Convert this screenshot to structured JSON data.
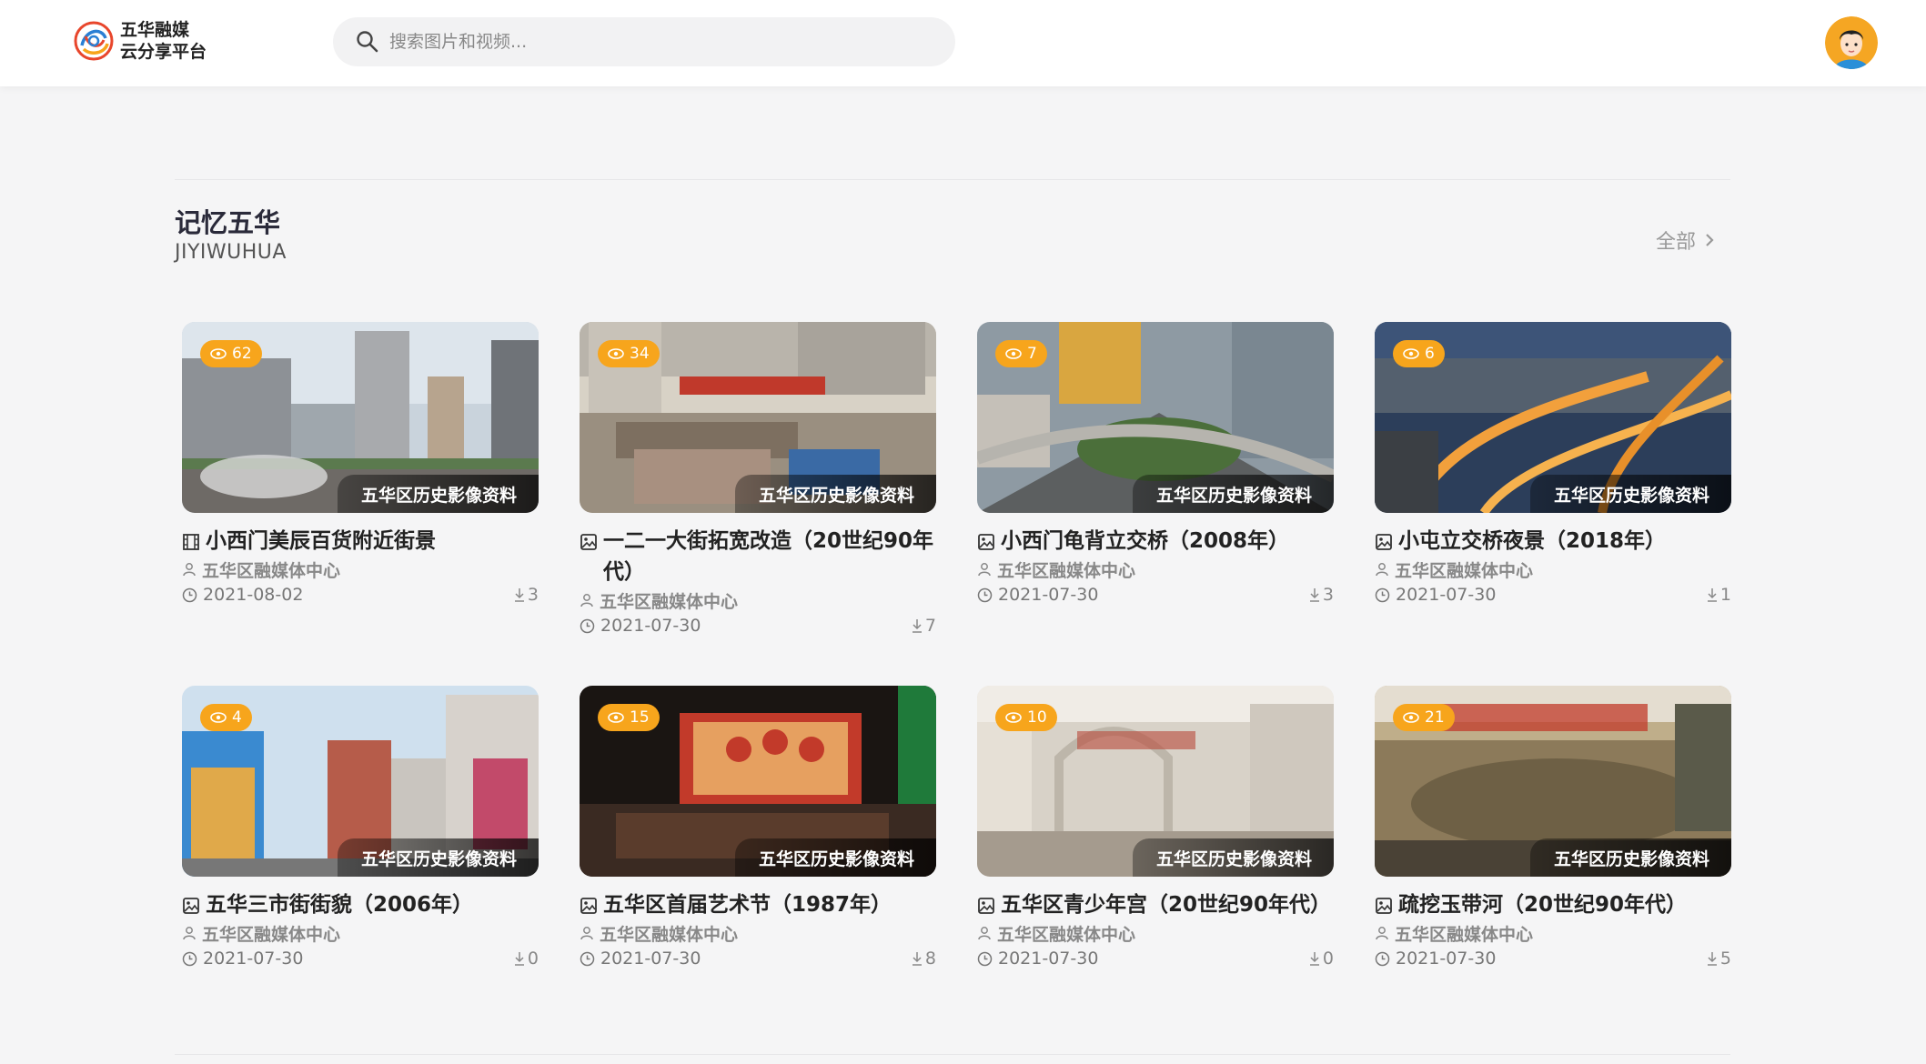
{
  "brand": {
    "line1": "五华融媒",
    "line2": "云分享平台"
  },
  "search": {
    "placeholder": "搜索图片和视频..."
  },
  "section": {
    "title": "记忆五华",
    "subtitle": "JIYIWUHUA",
    "more_label": "全部"
  },
  "colors": {
    "accent": "#f7a51c",
    "text": "#222222",
    "muted": "#888888"
  },
  "cards": [
    {
      "title": "小西门美辰百货附近街景",
      "type": "video",
      "type_icon": "film-icon",
      "views": "62",
      "tag": "五华区历史影像资料",
      "author": "五华区融媒体中心",
      "date": "2021-08-02",
      "downloads": "3"
    },
    {
      "title": "一二一大街拓宽改造（20世纪90年代）",
      "type": "image",
      "type_icon": "image-icon",
      "views": "34",
      "tag": "五华区历史影像资料",
      "author": "五华区融媒体中心",
      "date": "2021-07-30",
      "downloads": "7"
    },
    {
      "title": "小西门龟背立交桥（2008年）",
      "type": "image",
      "type_icon": "image-icon",
      "views": "7",
      "tag": "五华区历史影像资料",
      "author": "五华区融媒体中心",
      "date": "2021-07-30",
      "downloads": "3"
    },
    {
      "title": "小屯立交桥夜景（2018年）",
      "type": "image",
      "type_icon": "image-icon",
      "views": "6",
      "tag": "五华区历史影像资料",
      "author": "五华区融媒体中心",
      "date": "2021-07-30",
      "downloads": "1"
    },
    {
      "title": "五华三市街街貌（2006年）",
      "type": "image",
      "type_icon": "image-icon",
      "views": "4",
      "tag": "五华区历史影像资料",
      "author": "五华区融媒体中心",
      "date": "2021-07-30",
      "downloads": "0"
    },
    {
      "title": "五华区首届艺术节（1987年）",
      "type": "image",
      "type_icon": "image-icon",
      "views": "15",
      "tag": "五华区历史影像资料",
      "author": "五华区融媒体中心",
      "date": "2021-07-30",
      "downloads": "8"
    },
    {
      "title": "五华区青少年宫（20世纪90年代）",
      "type": "image",
      "type_icon": "image-icon",
      "views": "10",
      "tag": "五华区历史影像资料",
      "author": "五华区融媒体中心",
      "date": "2021-07-30",
      "downloads": "0"
    },
    {
      "title": "疏挖玉带河（20世纪90年代）",
      "type": "image",
      "type_icon": "image-icon",
      "views": "21",
      "tag": "五华区历史影像资料",
      "author": "五华区融媒体中心",
      "date": "2021-07-30",
      "downloads": "5"
    }
  ]
}
